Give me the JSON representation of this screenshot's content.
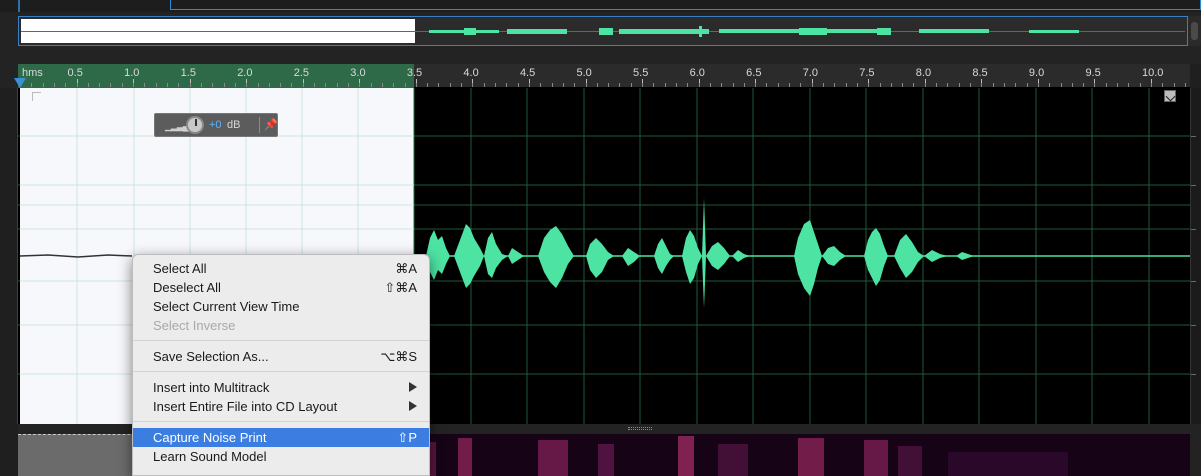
{
  "hud": {
    "gain_value": "+0",
    "gain_unit": "dB",
    "meter_icon": "level-meter-icon",
    "pin_icon": "pin-icon"
  },
  "ruler": {
    "unit": "hms",
    "ticks": [
      "0.5",
      "1.0",
      "1.5",
      "2.0",
      "2.5",
      "3.0",
      "3.5",
      "4.0",
      "4.5",
      "5.0",
      "5.5",
      "6.0",
      "6.5",
      "7.0",
      "7.5",
      "8.0",
      "8.5",
      "9.0",
      "9.5",
      "10.0"
    ]
  },
  "context_menu": {
    "groups": [
      [
        {
          "label": "Select All",
          "shortcut": "⌘A"
        },
        {
          "label": "Deselect All",
          "shortcut": "⇧⌘A"
        },
        {
          "label": "Select Current View Time",
          "shortcut": ""
        },
        {
          "label": "Select Inverse",
          "shortcut": "",
          "disabled": true
        }
      ],
      [
        {
          "label": "Save Selection As...",
          "shortcut": "⌥⌘S"
        }
      ],
      [
        {
          "label": "Insert into Multitrack",
          "submenu": true
        },
        {
          "label": "Insert Entire File into CD Layout",
          "submenu": true
        }
      ],
      [
        {
          "label": "Capture Noise Print",
          "shortcut": "⇧P",
          "highlighted": true
        },
        {
          "label": "Learn Sound Model",
          "shortcut": ""
        }
      ]
    ]
  },
  "colors": {
    "waveform": "#4de3a3",
    "selection": "#f7f8fc",
    "ruler_selection": "#2e6a48",
    "menu_highlight": "#3b7de0",
    "playhead": "#3a8fd6"
  }
}
